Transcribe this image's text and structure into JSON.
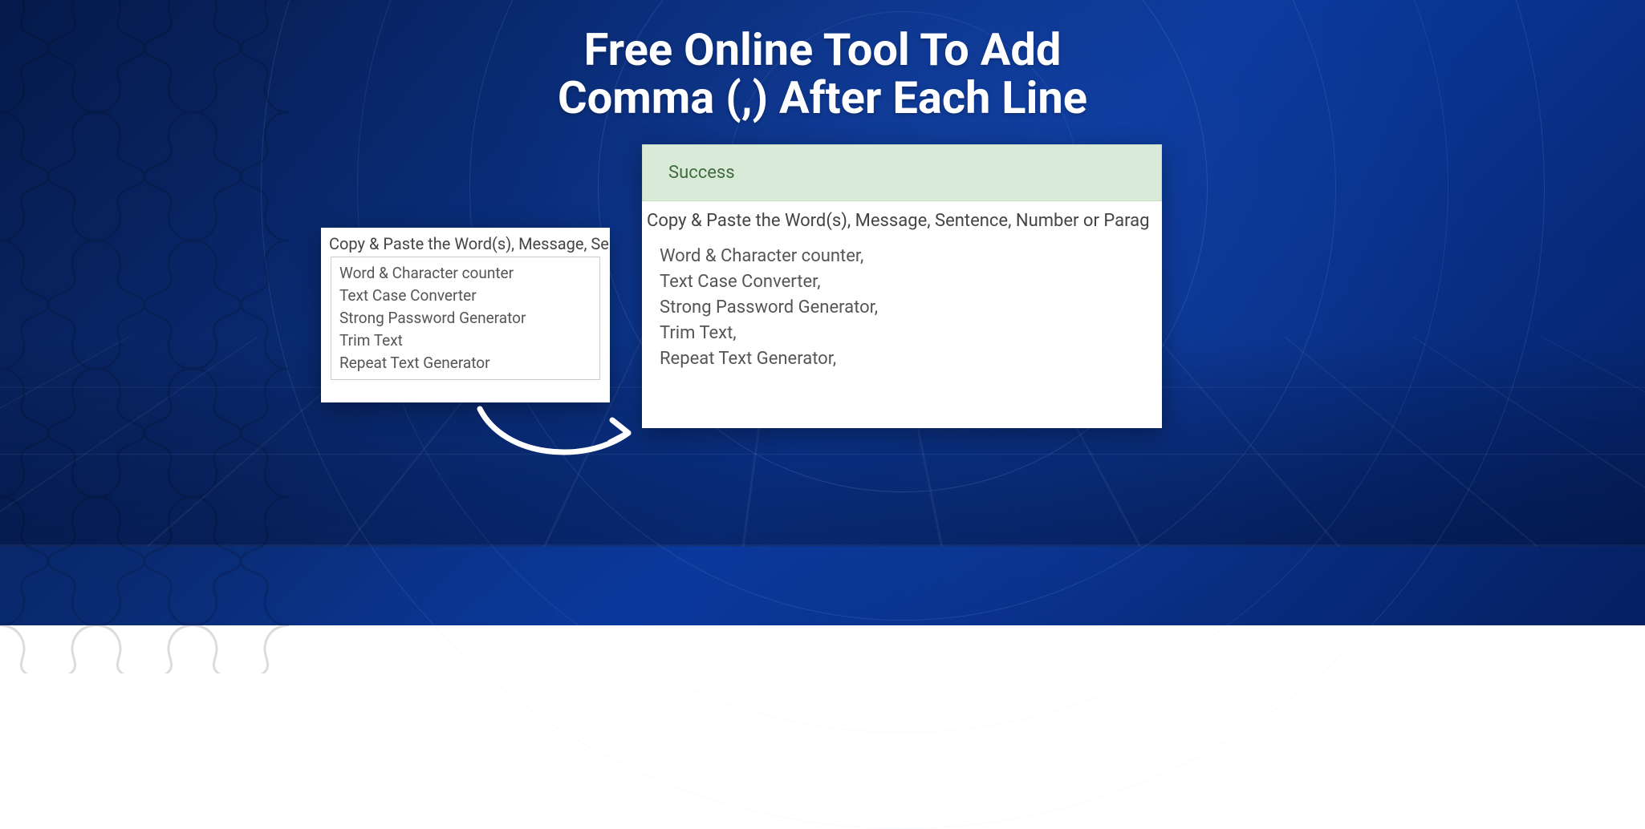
{
  "page_title_line1": "Free Online Tool To Add",
  "page_title_line2": "Comma (,) After Each Line",
  "panel_left": {
    "instruction": "Copy & Paste the Word(s), Message, Se",
    "lines": [
      "Word & Character counter",
      "Text Case Converter",
      "Strong Password Generator",
      "Trim Text",
      "Repeat Text Generator"
    ]
  },
  "panel_right": {
    "success_label": "Success",
    "instruction": "Copy & Paste the Word(s), Message, Sentence, Number or Parag",
    "lines": [
      "Word & Character counter,",
      "Text Case Converter,",
      "Strong Password Generator,",
      "Trim Text,",
      "Repeat Text Generator,"
    ]
  }
}
